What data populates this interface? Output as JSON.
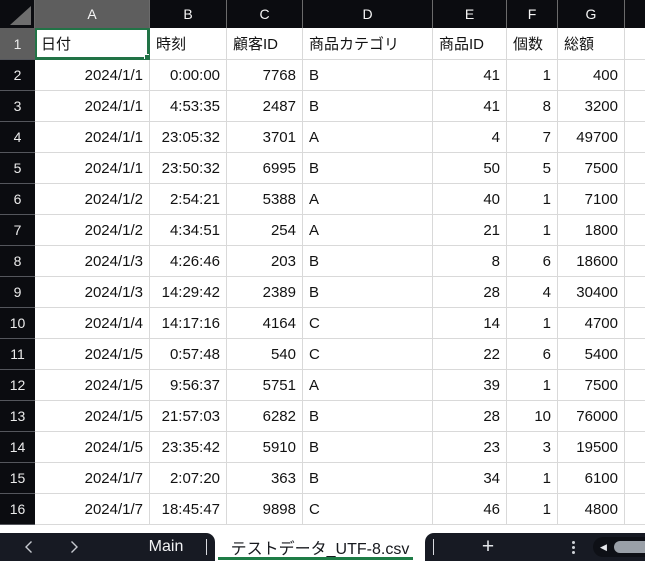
{
  "sheet": {
    "column_letters": [
      "A",
      "B",
      "C",
      "D",
      "E",
      "F",
      "G"
    ],
    "selected_column": "A",
    "selected_row": "1",
    "active_cell": "A1",
    "rows": [
      {
        "n": "1",
        "cells": [
          "日付",
          "時刻",
          "顧客ID",
          "商品カテゴリ",
          "商品ID",
          "個数",
          "総額"
        ]
      },
      {
        "n": "2",
        "cells": [
          "2024/1/1",
          "0:00:00",
          "7768",
          "B",
          "41",
          "1",
          "400"
        ]
      },
      {
        "n": "3",
        "cells": [
          "2024/1/1",
          "4:53:35",
          "2487",
          "B",
          "41",
          "8",
          "3200"
        ]
      },
      {
        "n": "4",
        "cells": [
          "2024/1/1",
          "23:05:32",
          "3701",
          "A",
          "4",
          "7",
          "49700"
        ]
      },
      {
        "n": "5",
        "cells": [
          "2024/1/1",
          "23:50:32",
          "6995",
          "B",
          "50",
          "5",
          "7500"
        ]
      },
      {
        "n": "6",
        "cells": [
          "2024/1/2",
          "2:54:21",
          "5388",
          "A",
          "40",
          "1",
          "7100"
        ]
      },
      {
        "n": "7",
        "cells": [
          "2024/1/2",
          "4:34:51",
          "254",
          "A",
          "21",
          "1",
          "1800"
        ]
      },
      {
        "n": "8",
        "cells": [
          "2024/1/3",
          "4:26:46",
          "203",
          "B",
          "8",
          "6",
          "18600"
        ]
      },
      {
        "n": "9",
        "cells": [
          "2024/1/3",
          "14:29:42",
          "2389",
          "B",
          "28",
          "4",
          "30400"
        ]
      },
      {
        "n": "10",
        "cells": [
          "2024/1/4",
          "14:17:16",
          "4164",
          "C",
          "14",
          "1",
          "4700"
        ]
      },
      {
        "n": "11",
        "cells": [
          "2024/1/5",
          "0:57:48",
          "540",
          "C",
          "22",
          "6",
          "5400"
        ]
      },
      {
        "n": "12",
        "cells": [
          "2024/1/5",
          "9:56:37",
          "5751",
          "A",
          "39",
          "1",
          "7500"
        ]
      },
      {
        "n": "13",
        "cells": [
          "2024/1/5",
          "21:57:03",
          "6282",
          "B",
          "28",
          "10",
          "76000"
        ]
      },
      {
        "n": "14",
        "cells": [
          "2024/1/5",
          "23:35:42",
          "5910",
          "B",
          "23",
          "3",
          "19500"
        ]
      },
      {
        "n": "15",
        "cells": [
          "2024/1/7",
          "2:07:20",
          "363",
          "B",
          "34",
          "1",
          "6100"
        ]
      },
      {
        "n": "16",
        "cells": [
          "2024/1/7",
          "18:45:47",
          "9898",
          "C",
          "46",
          "1",
          "4800"
        ]
      }
    ]
  },
  "tab_bar": {
    "back_icon": "chevron-left-icon",
    "forward_icon": "chevron-right-icon",
    "tabs": [
      {
        "label": "Main",
        "active": false
      },
      {
        "label": "テストデータ_UTF-8.csv",
        "active": true
      }
    ],
    "add_label": "+",
    "menu_icon": "kebab-menu-icon",
    "scroll_left_glyph": "◀",
    "select_all_icon": "select-all-triangle-icon"
  },
  "colors": {
    "header_bg": "#0b0c10",
    "selected_header_bg": "#5e5e5e",
    "gridline": "#d9d9d9",
    "selection_green": "#217346",
    "tab_bar_bg": "#171a23",
    "active_tab_underline": "#1e7c46",
    "scroll_thumb": "#9aa0a8"
  }
}
